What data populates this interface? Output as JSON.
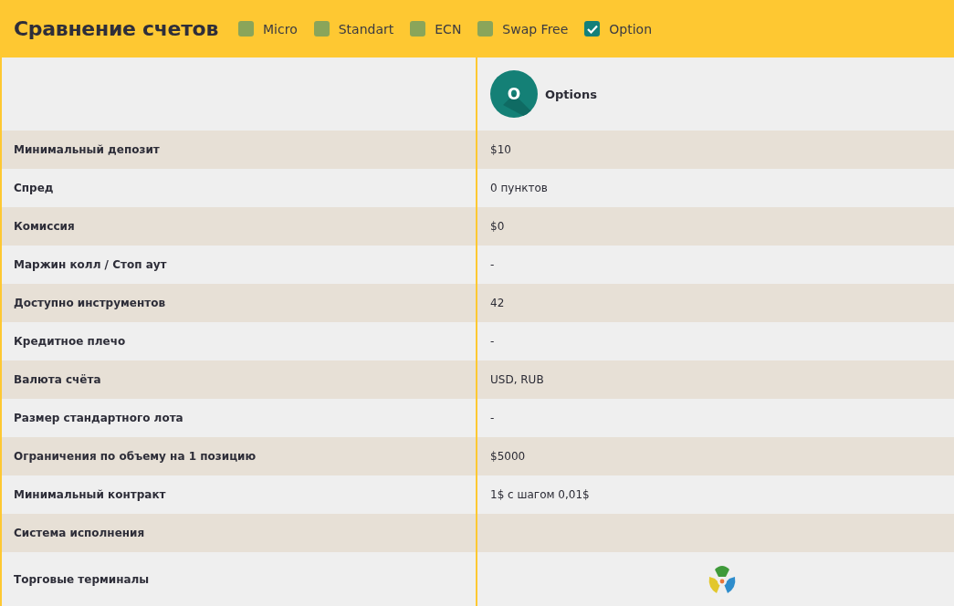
{
  "header": {
    "title": "Сравнение счетов",
    "filters": [
      {
        "label": "Micro",
        "checked": false
      },
      {
        "label": "Standart",
        "checked": false
      },
      {
        "label": "ECN",
        "checked": false
      },
      {
        "label": "Swap Free",
        "checked": false
      },
      {
        "label": "Option",
        "checked": true
      }
    ]
  },
  "account": {
    "badge": "O",
    "name": "Options"
  },
  "rows": [
    {
      "kind": "text",
      "label": "Минимальный депозит",
      "value": "$10"
    },
    {
      "kind": "text",
      "label": "Спред",
      "value": "0 пунктов"
    },
    {
      "kind": "text",
      "label": "Комиссия",
      "value": "$0"
    },
    {
      "kind": "text",
      "label": "Маржин колл / Стоп аут",
      "value": "-"
    },
    {
      "kind": "text",
      "label": "Доступно инструментов",
      "value": "42"
    },
    {
      "kind": "text",
      "label": "Кредитное плечо",
      "value": "-"
    },
    {
      "kind": "text",
      "label": "Валюта счёта",
      "value": "USD, RUB"
    },
    {
      "kind": "text",
      "label": "Размер стандартного лота",
      "value": "-"
    },
    {
      "kind": "text",
      "label": "Ограничения по объему на 1 позицию",
      "value": "$5000"
    },
    {
      "kind": "text",
      "label": "Минимальный контракт",
      "value": "1$ с шагом 0,01$"
    },
    {
      "kind": "text",
      "label": "Система исполнения"
    },
    {
      "kind": "terminal",
      "label": "Торговые терминалы"
    }
  ]
}
